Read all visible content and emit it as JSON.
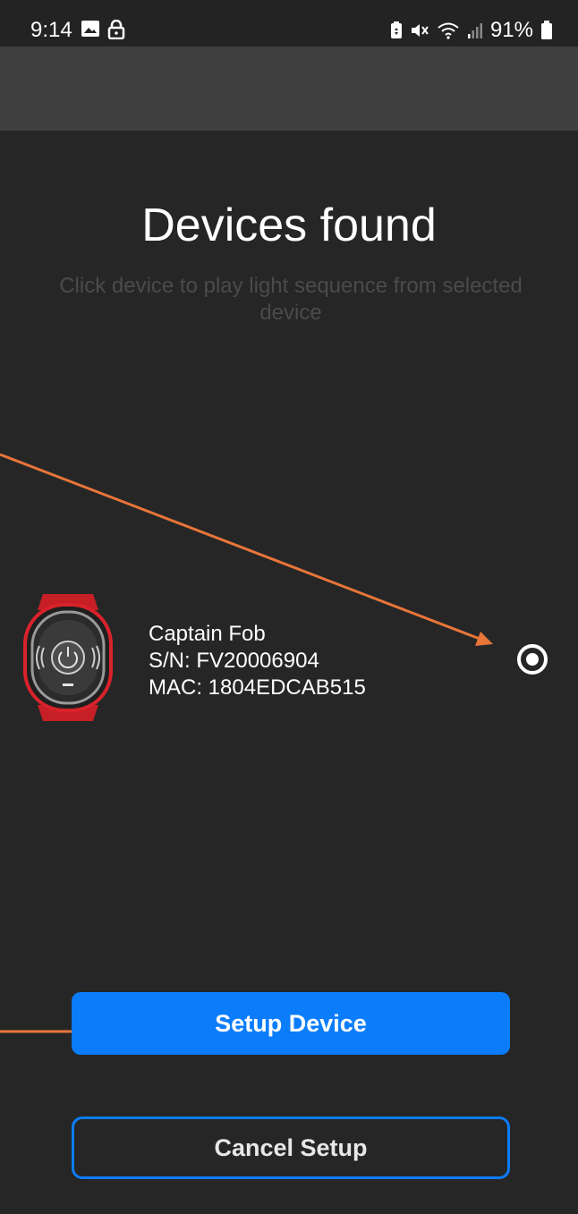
{
  "status_bar": {
    "time": "9:14",
    "battery_percent": "91%",
    "left_icons": [
      "image-icon",
      "lock-icon"
    ],
    "right_icons": [
      "battery-saver-icon",
      "mute-icon",
      "wifi-icon",
      "signal-icon",
      "battery-icon"
    ]
  },
  "page": {
    "title": "Devices found",
    "subtitle": "Click device to play light sequence from selected device"
  },
  "device": {
    "name": "Captain Fob",
    "serial": "S/N: FV20006904",
    "mac": "MAC: 1804EDCAB515",
    "selected": true
  },
  "buttons": {
    "setup_label": "Setup Device",
    "cancel_label": "Cancel Setup"
  },
  "colors": {
    "background": "#262626",
    "app_bar": "#3f3f3f",
    "accent": "#0b7dfb",
    "annotation_arrow": "#e8763a",
    "device_red": "#d8232a"
  }
}
